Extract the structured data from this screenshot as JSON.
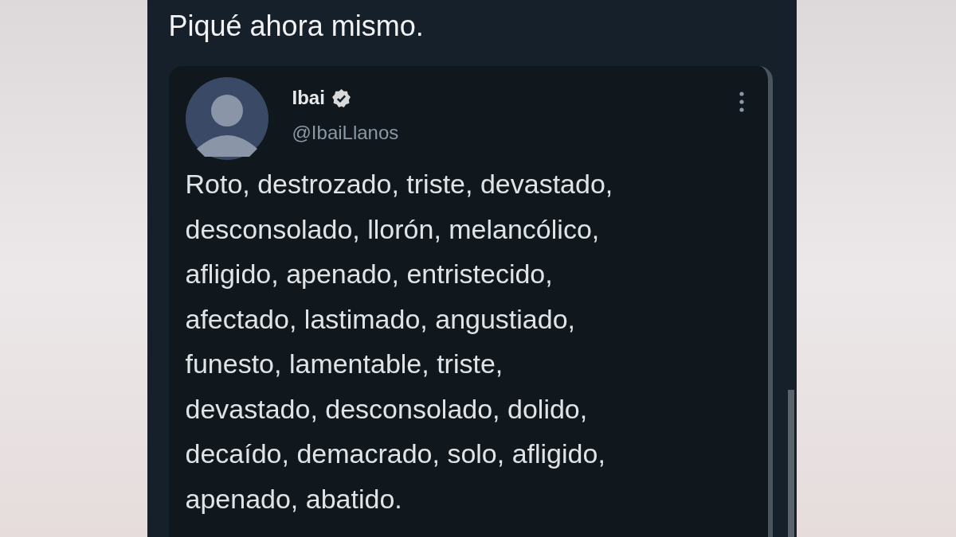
{
  "caption": "Piqué ahora mismo.",
  "tweet": {
    "name": "Ibai",
    "verified": true,
    "handle": "@IbaiLlanos",
    "text_lines": [
      "Roto, destrozado, triste, devastado,",
      "desconsolado, llorón, melancólico,",
      "afligido, apenado, entristecido,",
      "afectado, lastimado, angustiado,",
      "funesto, lamentable, triste,",
      "devastado, desconsolado, dolido,",
      "decaído, demacrado, solo, afligido,",
      "apenado, abatido."
    ]
  }
}
